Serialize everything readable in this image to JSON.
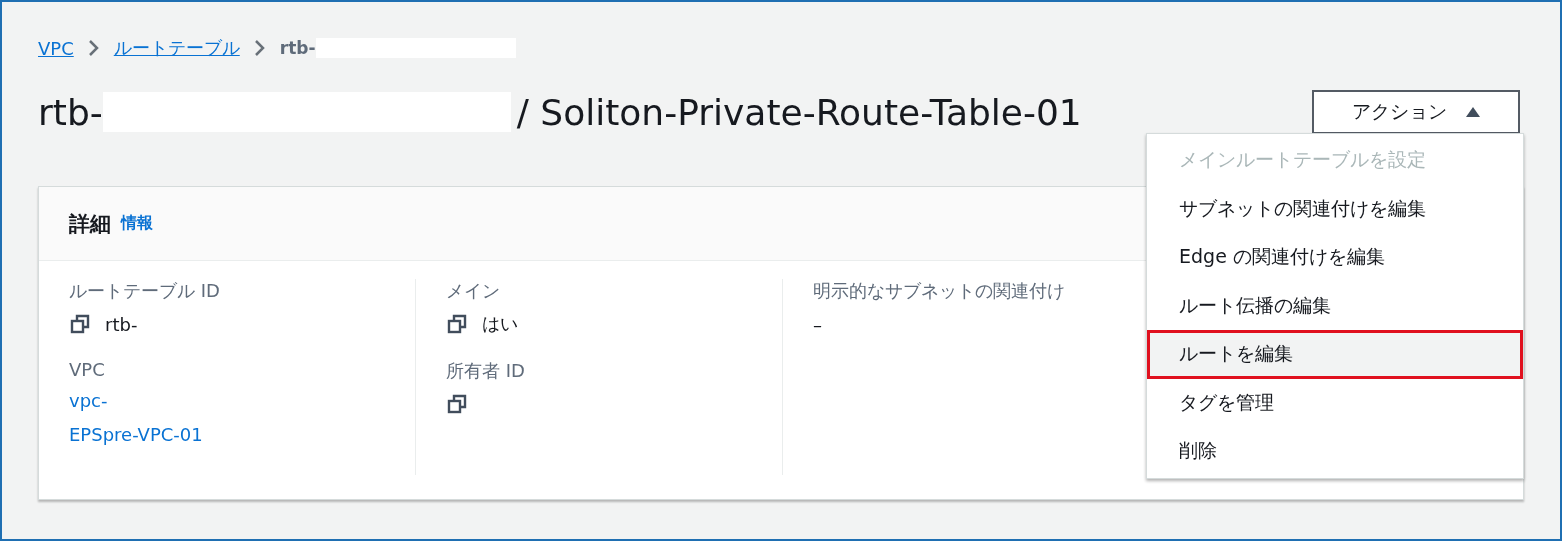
{
  "breadcrumb": [
    {
      "label": "VPC",
      "kind": "link"
    },
    {
      "label": "ルートテーブル",
      "kind": "link"
    },
    {
      "label": "rtb-",
      "kind": "current"
    }
  ],
  "title": {
    "id": "rtb-",
    "name": "/ Soliton-Private-Route-Table-01"
  },
  "actions_button": {
    "label": "アクション",
    "expanded": true
  },
  "actions_menu": [
    {
      "label": "メインルートテーブルを設定",
      "disabled": true,
      "highlighted": false
    },
    {
      "label": "サブネットの関連付けを編集",
      "disabled": false,
      "highlighted": false
    },
    {
      "label": "Edge の関連付けを編集",
      "disabled": false,
      "highlighted": false
    },
    {
      "label": "ルート伝播の編集",
      "disabled": false,
      "highlighted": false
    },
    {
      "label": "ルートを編集",
      "disabled": false,
      "highlighted": true
    },
    {
      "label": "タグを管理",
      "disabled": false,
      "highlighted": false
    },
    {
      "label": "削除",
      "disabled": false,
      "highlighted": false
    }
  ],
  "details": {
    "heading": "詳細",
    "info_link": "情報",
    "columns": [
      [
        {
          "label": "ルートテーブル ID",
          "value": "rtb-",
          "kind": "copy"
        },
        {
          "label": "VPC",
          "value": "vpc-\nEPSpre-VPC-01",
          "kind": "link"
        }
      ],
      [
        {
          "label": "メイン",
          "value": "はい",
          "kind": "copy"
        },
        {
          "label": "所有者 ID",
          "kind": "copy"
        }
      ],
      [
        {
          "label": "明示的なサブネットの関連付け",
          "value": "–",
          "kind": "text"
        }
      ]
    ]
  }
}
